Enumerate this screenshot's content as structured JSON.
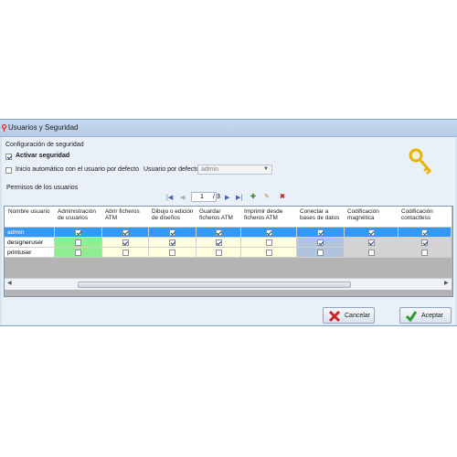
{
  "window": {
    "title": "Usuarios y Seguridad"
  },
  "security": {
    "group_label": "Configuración de seguridad",
    "activate_label": "Activar seguridad",
    "activate_checked": true,
    "autostart_label": "Inicio automático con el usuario por defecto",
    "autostart_checked": false,
    "default_user_label": "Usuario por defecto:",
    "default_user_value": "admin"
  },
  "permissions": {
    "group_label": "Permisos de los usuarios",
    "pager": {
      "current": "1",
      "separator": "/",
      "total": "3"
    },
    "columns": [
      "Nombre usuario",
      "Administración de usuarios",
      "Abrir ficheros ATM",
      "Dibujo o edición de diseños",
      "Guardar ficheros ATM",
      "Imprimir desde ficheros ATM",
      "Conectar a bases de datos",
      "Codificación magnética",
      "Codificación contactless"
    ],
    "rows": [
      {
        "name": "admin",
        "selected": true,
        "values": [
          true,
          true,
          true,
          true,
          true,
          true,
          true,
          true
        ]
      },
      {
        "name": "designeruser",
        "selected": false,
        "values": [
          false,
          true,
          true,
          true,
          false,
          true,
          true,
          true
        ]
      },
      {
        "name": "printuser",
        "selected": false,
        "values": [
          false,
          false,
          false,
          false,
          false,
          false,
          false,
          false
        ]
      }
    ]
  },
  "buttons": {
    "cancel": "Cancelar",
    "accept": "Aceptar"
  },
  "colors": {
    "selected_row": "#3399ff",
    "admin_column": "#90ee90",
    "yellow_cells": "#ffffe0",
    "blue_cells": "#b0c4de",
    "gray_cells": "#d3d3d3"
  }
}
